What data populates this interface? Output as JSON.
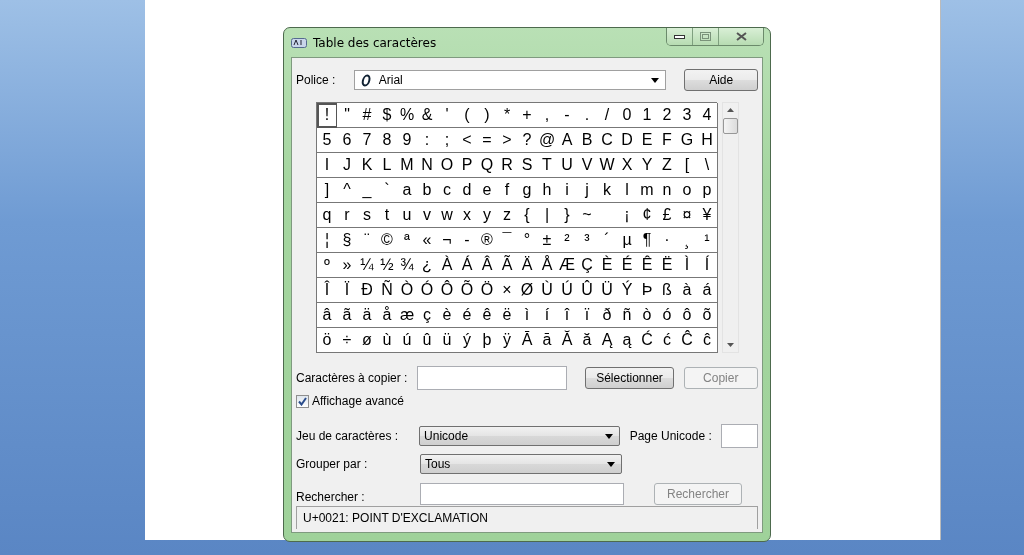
{
  "window": {
    "title": "Table des caractères"
  },
  "font": {
    "label": "Police :",
    "value": "Arial"
  },
  "help_button": {
    "label": "Aide"
  },
  "grid": {
    "rows": [
      [
        {
          "c": "!",
          "selected": true
        },
        {
          "c": "\"",
          "selected": false
        },
        {
          "c": "#",
          "selected": false
        },
        {
          "c": "$",
          "selected": false
        },
        {
          "c": "%",
          "selected": false
        },
        {
          "c": "&",
          "selected": false
        },
        {
          "c": "'",
          "selected": false
        },
        {
          "c": "(",
          "selected": false
        },
        {
          "c": ")",
          "selected": false
        },
        {
          "c": "*",
          "selected": false
        },
        {
          "c": "+",
          "selected": false
        },
        {
          "c": ",",
          "selected": false
        },
        {
          "c": "-",
          "selected": false
        },
        {
          "c": ".",
          "selected": false
        },
        {
          "c": "/",
          "selected": false
        },
        {
          "c": "0",
          "selected": false
        },
        {
          "c": "1",
          "selected": false
        },
        {
          "c": "2",
          "selected": false
        },
        {
          "c": "3",
          "selected": false
        },
        {
          "c": "4",
          "selected": false
        }
      ],
      [
        {
          "c": "5",
          "selected": false
        },
        {
          "c": "6",
          "selected": false
        },
        {
          "c": "7",
          "selected": false
        },
        {
          "c": "8",
          "selected": false
        },
        {
          "c": "9",
          "selected": false
        },
        {
          "c": ":",
          "selected": false
        },
        {
          "c": ";",
          "selected": false
        },
        {
          "c": "<",
          "selected": false
        },
        {
          "c": "=",
          "selected": false
        },
        {
          "c": ">",
          "selected": false
        },
        {
          "c": "?",
          "selected": false
        },
        {
          "c": "@",
          "selected": false
        },
        {
          "c": "A",
          "selected": false
        },
        {
          "c": "B",
          "selected": false
        },
        {
          "c": "C",
          "selected": false
        },
        {
          "c": "D",
          "selected": false
        },
        {
          "c": "E",
          "selected": false
        },
        {
          "c": "F",
          "selected": false
        },
        {
          "c": "G",
          "selected": false
        },
        {
          "c": "H",
          "selected": false
        }
      ],
      [
        {
          "c": "I",
          "selected": false
        },
        {
          "c": "J",
          "selected": false
        },
        {
          "c": "K",
          "selected": false
        },
        {
          "c": "L",
          "selected": false
        },
        {
          "c": "M",
          "selected": false
        },
        {
          "c": "N",
          "selected": false
        },
        {
          "c": "O",
          "selected": false
        },
        {
          "c": "P",
          "selected": false
        },
        {
          "c": "Q",
          "selected": false
        },
        {
          "c": "R",
          "selected": false
        },
        {
          "c": "S",
          "selected": false
        },
        {
          "c": "T",
          "selected": false
        },
        {
          "c": "U",
          "selected": false
        },
        {
          "c": "V",
          "selected": false
        },
        {
          "c": "W",
          "selected": false
        },
        {
          "c": "X",
          "selected": false
        },
        {
          "c": "Y",
          "selected": false
        },
        {
          "c": "Z",
          "selected": false
        },
        {
          "c": "[",
          "selected": false
        },
        {
          "c": "\\",
          "selected": false
        }
      ],
      [
        {
          "c": "]",
          "selected": false
        },
        {
          "c": "^",
          "selected": false
        },
        {
          "c": "_",
          "selected": false
        },
        {
          "c": "`",
          "selected": false
        },
        {
          "c": "a",
          "selected": false
        },
        {
          "c": "b",
          "selected": false
        },
        {
          "c": "c",
          "selected": false
        },
        {
          "c": "d",
          "selected": false
        },
        {
          "c": "e",
          "selected": false
        },
        {
          "c": "f",
          "selected": false
        },
        {
          "c": "g",
          "selected": false
        },
        {
          "c": "h",
          "selected": false
        },
        {
          "c": "i",
          "selected": false
        },
        {
          "c": "j",
          "selected": false
        },
        {
          "c": "k",
          "selected": false
        },
        {
          "c": "l",
          "selected": false
        },
        {
          "c": "m",
          "selected": false
        },
        {
          "c": "n",
          "selected": false
        },
        {
          "c": "o",
          "selected": false
        },
        {
          "c": "p",
          "selected": false
        }
      ],
      [
        {
          "c": "q",
          "selected": false
        },
        {
          "c": "r",
          "selected": false
        },
        {
          "c": "s",
          "selected": false
        },
        {
          "c": "t",
          "selected": false
        },
        {
          "c": "u",
          "selected": false
        },
        {
          "c": "v",
          "selected": false
        },
        {
          "c": "w",
          "selected": false
        },
        {
          "c": "x",
          "selected": false
        },
        {
          "c": "y",
          "selected": false
        },
        {
          "c": "z",
          "selected": false
        },
        {
          "c": "{",
          "selected": false
        },
        {
          "c": "|",
          "selected": false
        },
        {
          "c": "}",
          "selected": false
        },
        {
          "c": "~",
          "selected": false
        },
        {
          "selected": false
        },
        {
          "c": "¡",
          "selected": false
        },
        {
          "c": "¢",
          "selected": false
        },
        {
          "c": "£",
          "selected": false
        },
        {
          "c": "¤",
          "selected": false
        },
        {
          "c": "¥",
          "selected": false
        }
      ],
      [
        {
          "c": "¦",
          "selected": false
        },
        {
          "c": "§",
          "selected": false
        },
        {
          "c": "¨",
          "selected": false
        },
        {
          "c": "©",
          "selected": false
        },
        {
          "c": "ª",
          "selected": false
        },
        {
          "c": "«",
          "selected": false
        },
        {
          "c": "¬",
          "selected": false
        },
        {
          "c": "-",
          "selected": false
        },
        {
          "c": "®",
          "selected": false
        },
        {
          "c": "¯",
          "selected": false
        },
        {
          "c": "°",
          "selected": false
        },
        {
          "c": "±",
          "selected": false
        },
        {
          "c": "²",
          "selected": false
        },
        {
          "c": "³",
          "selected": false
        },
        {
          "c": "´",
          "selected": false
        },
        {
          "c": "µ",
          "selected": false
        },
        {
          "c": "¶",
          "selected": false
        },
        {
          "c": "·",
          "selected": false
        },
        {
          "c": "¸",
          "selected": false
        },
        {
          "c": "¹",
          "selected": false
        }
      ],
      [
        {
          "c": "º",
          "selected": false
        },
        {
          "c": "»",
          "selected": false
        },
        {
          "c": "¼",
          "selected": false
        },
        {
          "c": "½",
          "selected": false
        },
        {
          "c": "¾",
          "selected": false
        },
        {
          "c": "¿",
          "selected": false
        },
        {
          "c": "À",
          "selected": false
        },
        {
          "c": "Á",
          "selected": false
        },
        {
          "c": "Â",
          "selected": false
        },
        {
          "c": "Ã",
          "selected": false
        },
        {
          "c": "Ä",
          "selected": false
        },
        {
          "c": "Å",
          "selected": false
        },
        {
          "c": "Æ",
          "selected": false
        },
        {
          "c": "Ç",
          "selected": false
        },
        {
          "c": "È",
          "selected": false
        },
        {
          "c": "É",
          "selected": false
        },
        {
          "c": "Ê",
          "selected": false
        },
        {
          "c": "Ë",
          "selected": false
        },
        {
          "c": "Ì",
          "selected": false
        },
        {
          "c": "Í",
          "selected": false
        }
      ],
      [
        {
          "c": "Î",
          "selected": false
        },
        {
          "c": "Ï",
          "selected": false
        },
        {
          "c": "Ð",
          "selected": false
        },
        {
          "c": "Ñ",
          "selected": false
        },
        {
          "c": "Ò",
          "selected": false
        },
        {
          "c": "Ó",
          "selected": false
        },
        {
          "c": "Ô",
          "selected": false
        },
        {
          "c": "Õ",
          "selected": false
        },
        {
          "c": "Ö",
          "selected": false
        },
        {
          "c": "×",
          "selected": false
        },
        {
          "c": "Ø",
          "selected": false
        },
        {
          "c": "Ù",
          "selected": false
        },
        {
          "c": "Ú",
          "selected": false
        },
        {
          "c": "Û",
          "selected": false
        },
        {
          "c": "Ü",
          "selected": false
        },
        {
          "c": "Ý",
          "selected": false
        },
        {
          "c": "Þ",
          "selected": false
        },
        {
          "c": "ß",
          "selected": false
        },
        {
          "c": "à",
          "selected": false
        },
        {
          "c": "á",
          "selected": false
        }
      ],
      [
        {
          "c": "â",
          "selected": false
        },
        {
          "c": "ã",
          "selected": false
        },
        {
          "c": "ä",
          "selected": false
        },
        {
          "c": "å",
          "selected": false
        },
        {
          "c": "æ",
          "selected": false
        },
        {
          "c": "ç",
          "selected": false
        },
        {
          "c": "è",
          "selected": false
        },
        {
          "c": "é",
          "selected": false
        },
        {
          "c": "ê",
          "selected": false
        },
        {
          "c": "ë",
          "selected": false
        },
        {
          "c": "ì",
          "selected": false
        },
        {
          "c": "í",
          "selected": false
        },
        {
          "c": "î",
          "selected": false
        },
        {
          "c": "ï",
          "selected": false
        },
        {
          "c": "ð",
          "selected": false
        },
        {
          "c": "ñ",
          "selected": false
        },
        {
          "c": "ò",
          "selected": false
        },
        {
          "c": "ó",
          "selected": false
        },
        {
          "c": "ô",
          "selected": false
        },
        {
          "c": "õ",
          "selected": false
        }
      ],
      [
        {
          "c": "ö",
          "selected": false
        },
        {
          "c": "÷",
          "selected": false
        },
        {
          "c": "ø",
          "selected": false
        },
        {
          "c": "ù",
          "selected": false
        },
        {
          "c": "ú",
          "selected": false
        },
        {
          "c": "û",
          "selected": false
        },
        {
          "c": "ü",
          "selected": false
        },
        {
          "c": "ý",
          "selected": false
        },
        {
          "c": "þ",
          "selected": false
        },
        {
          "c": "ÿ",
          "selected": false
        },
        {
          "c": "Ā",
          "selected": false
        },
        {
          "c": "ā",
          "selected": false
        },
        {
          "c": "Ă",
          "selected": false
        },
        {
          "c": "ă",
          "selected": false
        },
        {
          "c": "Ą",
          "selected": false
        },
        {
          "c": "ą",
          "selected": false
        },
        {
          "c": "Ć",
          "selected": false
        },
        {
          "c": "ć",
          "selected": false
        },
        {
          "c": "Ĉ",
          "selected": false
        },
        {
          "c": "ĉ",
          "selected": false
        }
      ]
    ]
  },
  "copy": {
    "label": "Caractères à copier :"
  },
  "select_button": {
    "label": "Sélectionner",
    "disabled": false
  },
  "copy_button": {
    "label": "Copier",
    "disabled": true
  },
  "advanced_view": {
    "label": "Affichage avancé",
    "checked": true
  },
  "charset": {
    "label": "Jeu de caractères :",
    "value": "Unicode"
  },
  "unicode_page": {
    "label": "Page Unicode :"
  },
  "group_by": {
    "label": "Grouper par :",
    "value": "Tous"
  },
  "search": {
    "label": "Rechercher :"
  },
  "search_button": {
    "label": "Rechercher",
    "disabled": true
  },
  "status_bar": "U+0021: POINT D'EXCLAMATION"
}
